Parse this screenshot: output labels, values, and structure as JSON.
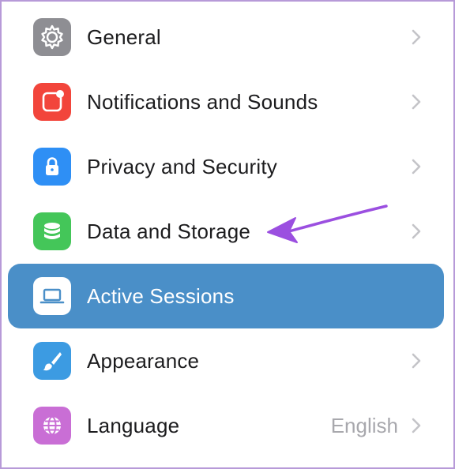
{
  "settings": {
    "items": [
      {
        "label": "General",
        "icon": "gear-icon",
        "color": "#8e8e93"
      },
      {
        "label": "Notifications and Sounds",
        "icon": "notification-badge-icon",
        "color": "#f2453b"
      },
      {
        "label": "Privacy and Security",
        "icon": "lock-icon",
        "color": "#2e8ff5"
      },
      {
        "label": "Data and Storage",
        "icon": "database-icon",
        "color": "#44c659"
      },
      {
        "label": "Active Sessions",
        "icon": "laptop-icon",
        "color": "#ffffff",
        "selected": true
      },
      {
        "label": "Appearance",
        "icon": "brush-icon",
        "color": "#3c9be2"
      },
      {
        "label": "Language",
        "icon": "globe-icon",
        "color": "#c96ed5",
        "value": "English"
      }
    ]
  },
  "annotation": {
    "icon": "arrow-icon",
    "color": "#9b4fe0"
  }
}
